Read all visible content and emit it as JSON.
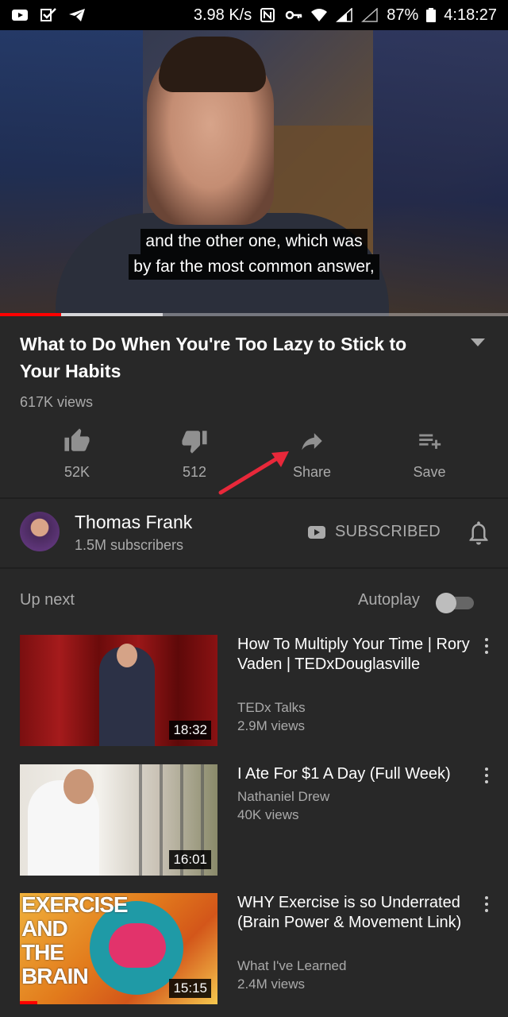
{
  "status_bar": {
    "speed": "3.98 K/s",
    "battery": "87%",
    "time": "4:18:27"
  },
  "player": {
    "captions": [
      "and the other one, which was",
      "by far the most common answer,"
    ],
    "progress_played_fraction": 0.12,
    "progress_buffered_fraction": 0.32
  },
  "video": {
    "title": "What to Do When You're Too Lazy to Stick to Your Habits",
    "views": "617K views"
  },
  "actions": [
    {
      "icon": "thumbs-up-icon",
      "label": "52K"
    },
    {
      "icon": "thumbs-down-icon",
      "label": "512"
    },
    {
      "icon": "share-icon",
      "label": "Share"
    },
    {
      "icon": "playlist-add-icon",
      "label": "Save"
    }
  ],
  "channel": {
    "name": "Thomas Frank",
    "subscribers": "1.5M subscribers",
    "subscribed_label": "SUBSCRIBED"
  },
  "up_next": {
    "label": "Up next",
    "autoplay_label": "Autoplay",
    "autoplay_on": false
  },
  "videos": [
    {
      "title": "How To Multiply Your Time | Rory Vaden | TEDxDouglasville",
      "channel": "TEDx Talks",
      "views": "2.9M views",
      "duration": "18:32"
    },
    {
      "title": "I Ate For $1 A Day (Full Week)",
      "channel": "Nathaniel Drew",
      "views": "40K views",
      "duration": "16:01"
    },
    {
      "title": "WHY Exercise is so Underrated (Brain Power & Movement Link)",
      "channel": "What I've Learned",
      "views": "2.4M views",
      "duration": "15:15",
      "thumb_text": [
        "EXERCISE",
        "AND",
        "THE",
        "BRAIN"
      ]
    }
  ],
  "colors": {
    "background": "#282828",
    "progress": "#ff0000",
    "annotation_arrow": "#e8283a",
    "secondary_text": "#aaaaaa"
  }
}
